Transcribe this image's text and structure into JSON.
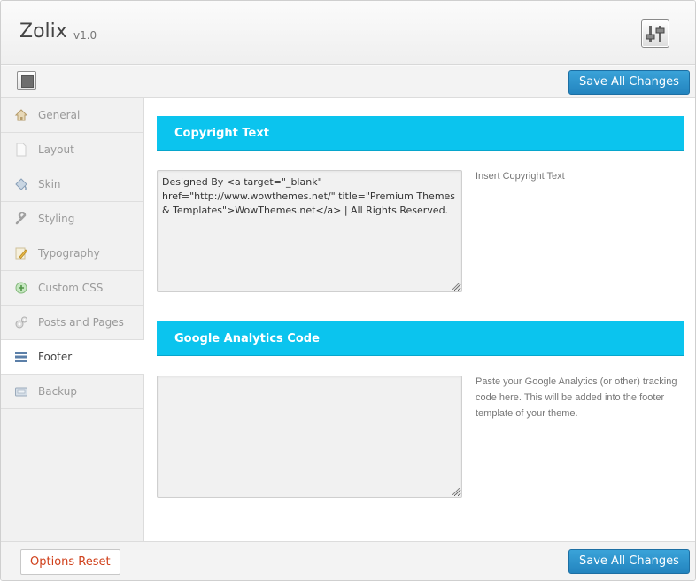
{
  "header": {
    "title": "Zolix",
    "version": "v1.0",
    "logo_icon": "sliders-icon"
  },
  "toolbar": {
    "save_label": "Save All Changes",
    "expand_icon": "expand-icon"
  },
  "sidebar": {
    "items": [
      {
        "label": "General",
        "icon": "home-icon",
        "active": false
      },
      {
        "label": "Layout",
        "icon": "page-icon",
        "active": false
      },
      {
        "label": "Skin",
        "icon": "paint-bucket-icon",
        "active": false
      },
      {
        "label": "Styling",
        "icon": "wrench-icon",
        "active": false
      },
      {
        "label": "Typography",
        "icon": "pencil-icon",
        "active": false
      },
      {
        "label": "Custom CSS",
        "icon": "plus-circle-icon",
        "active": false
      },
      {
        "label": "Posts and Pages",
        "icon": "gears-icon",
        "active": false
      },
      {
        "label": "Footer",
        "icon": "rows-icon",
        "active": true
      },
      {
        "label": "Backup",
        "icon": "drive-icon",
        "active": false
      }
    ]
  },
  "sections": [
    {
      "heading": "Copyright Text",
      "value": "Designed By <a target=\"_blank\" href=\"http://www.wowthemes.net/\" title=\"Premium Themes & Templates\">WowThemes.net</a>  |  All Rights Reserved.",
      "description": "Insert Copyright Text"
    },
    {
      "heading": "Google Analytics Code",
      "value": "",
      "description": "Paste your Google Analytics (or other) tracking code here. This will be added into the footer template of your theme."
    }
  ],
  "footer": {
    "reset_label": "Options Reset",
    "save_label": "Save All Changes"
  },
  "colors": {
    "accent": "#0bc4ee",
    "button": "#2a8cc8",
    "reset_text": "#d0401b"
  }
}
